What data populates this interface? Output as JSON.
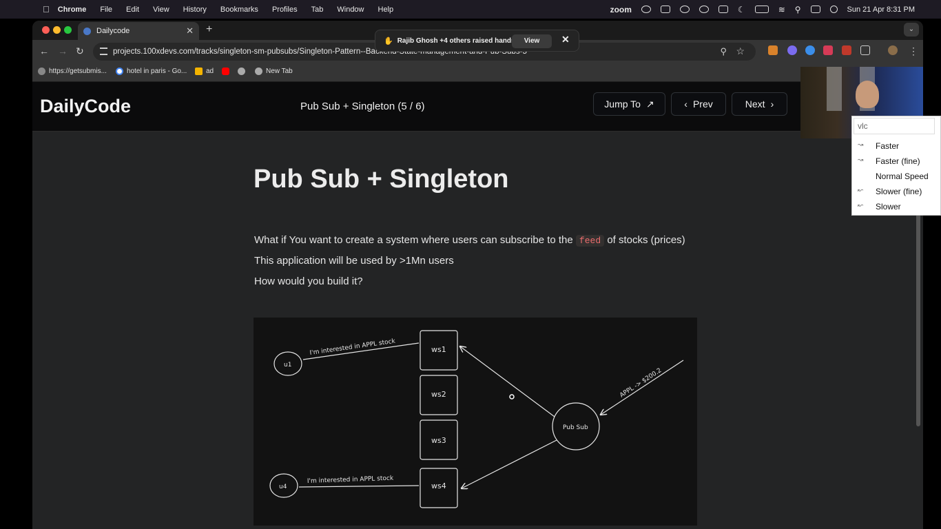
{
  "menubar": {
    "items": [
      "Chrome",
      "File",
      "Edit",
      "View",
      "History",
      "Bookmarks",
      "Profiles",
      "Tab",
      "Window",
      "Help"
    ],
    "zoom_label": "zoom",
    "clock": "Sun 21 Apr  8:31 PM"
  },
  "browser": {
    "tab_title": "Dailycode",
    "url": "projects.100xdevs.com/tracks/singleton-sm-pubsubs/Singleton-Pattern--Backend-State-management-and-Pub-Subs-5",
    "bookmarks": [
      "https://getsubmis...",
      "hotel in paris - Go...",
      "ad",
      "",
      "",
      "New Tab"
    ]
  },
  "zoom_notification": {
    "text": "Rajib Ghosh +4 others raised hands",
    "view_label": "View"
  },
  "site": {
    "logo": "DailyCode",
    "breadcrumb": "Pub Sub + Singleton (5 / 6)",
    "jump_label": "Jump To",
    "prev_label": "Prev",
    "next_label": "Next"
  },
  "article": {
    "title": "Pub Sub + Singleton",
    "line1_before": "What if You want to create a system where users can subscribe to the",
    "line1_code": "feed",
    "line1_after": "of stocks (prices)",
    "line2": "This application will be used by >1Mn users",
    "line3": "How would you build it?"
  },
  "diagram": {
    "user_top": "u1",
    "user_bottom": "u4",
    "servers": [
      "ws1",
      "ws2",
      "ws3",
      "ws4"
    ],
    "msg_top": "I'm interested in APPL stock",
    "msg_bottom": "I'm interested in APPL stock",
    "pubsub": "Pub Sub",
    "price": "APPL -> $200.2"
  },
  "vlc_menu": {
    "search": "vlc",
    "items": [
      "Faster",
      "Faster (fine)",
      "Normal Speed",
      "Slower (fine)",
      "Slower"
    ]
  }
}
